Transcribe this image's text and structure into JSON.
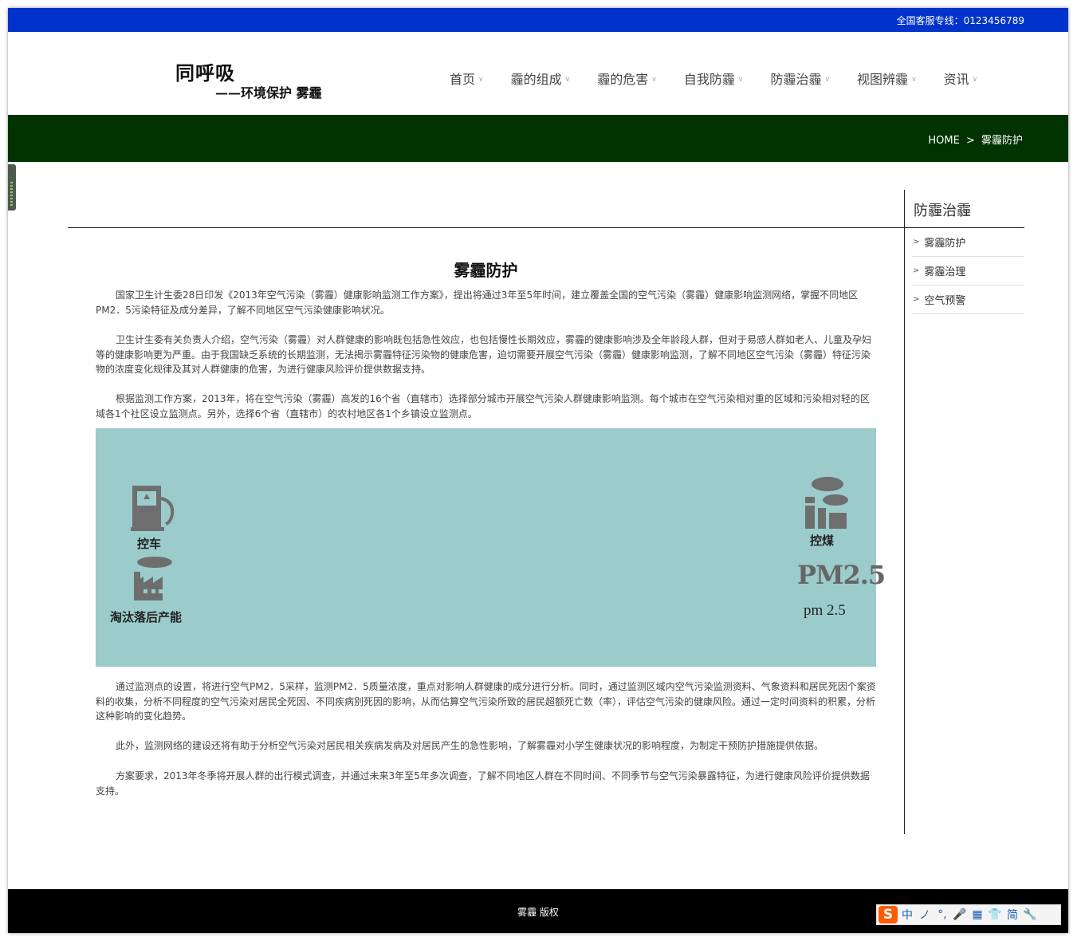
{
  "topbar": {
    "hotline": "全国客服专线：0123456789"
  },
  "logo": {
    "line1": "同呼吸",
    "line2": "——环境保护 雾霾"
  },
  "nav": {
    "items": [
      {
        "label": "首页"
      },
      {
        "label": "霾的组成"
      },
      {
        "label": "霾的危害"
      },
      {
        "label": "自我防霾"
      },
      {
        "label": "防霾治霾"
      },
      {
        "label": "视图辨霾"
      },
      {
        "label": "资讯"
      }
    ]
  },
  "breadcrumb": {
    "home": "HOME",
    "separator": ">",
    "current": "雾霾防护"
  },
  "sidebar": {
    "title": "防霾治霾",
    "items": [
      {
        "label": "雾霾防护"
      },
      {
        "label": "雾霾治理"
      },
      {
        "label": "空气预警"
      }
    ]
  },
  "article": {
    "title": "雾霾防护",
    "paragraphs": [
      "国家卫生计生委28日印发《2013年空气污染（雾霾）健康影响监测工作方案》，提出将通过3年至5年时间，建立覆盖全国的空气污染（雾霾）健康影响监测网络，掌握不同地区PM2．5污染特征及成分差异，了解不同地区空气污染健康影响状况。",
      "卫生计生委有关负责人介绍，空气污染（雾霾）对人群健康的影响既包括急性效应，也包括慢性长期效应，雾霾的健康影响涉及全年龄段人群，但对于易感人群如老人、儿童及孕妇等的健康影响更为严重。由于我国缺乏系统的长期监测，无法揭示雾霾特征污染物的健康危害，迫切需要开展空气污染（雾霾）健康影响监测，了解不同地区空气污染（雾霾）特征污染物的浓度变化规律及其对人群健康的危害，为进行健康风险评价提供数据支持。",
      "根据监测工作方案，2013年，将在空气污染（雾霾）高发的16个省（直辖市）选择部分城市开展空气污染人群健康影响监测。每个城市在空气污染相对重的区域和污染相对轻的区域各1个社区设立监测点。另外，选择6个省（直辖市）的农村地区各1个乡镇设立监测点。",
      "通过监测点的设置，将进行空气PM2．5采样，监测PM2．5质量浓度，重点对影响人群健康的成分进行分析。同时，通过监测区域内空气污染监测资料、气象资料和居民死因个案资料的收集，分析不同程度的空气污染对居民全死因、不同疾病别死因的影响，从而估算空气污染所致的居民超额死亡数（率），评估空气污染的健康风险。通过一定时间资料的积累，分析这种影响的变化趋势。",
      "此外，监测网络的建设还将有助于分析空气污染对居民相关疾病发病及对居民产生的急性影响，了解雾霾对小学生健康状况的影响程度，为制定干预防护措施提供依据。",
      "方案要求，2013年冬季将开展人群的出行模式调查，并通过未来3年至5年多次调查，了解不同地区人群在不同时间、不同季节与空气污染暴露特征，为进行健康风险评价提供数据支持。"
    ],
    "banner": {
      "label_car": "控车",
      "label_factory": "淘汰落后产能",
      "label_coal": "控煤",
      "pm_graphic": "PM2.5",
      "pm_text": "pm 2.5",
      "background": "#9ccbcb"
    }
  },
  "footer": {
    "copyright": "雾霾 版权"
  },
  "ime": {
    "logo": "S",
    "items": [
      "中",
      "ノ",
      "°,",
      "🎤",
      "▦",
      "👕",
      "简",
      "🔧"
    ]
  },
  "colors": {
    "topbar": "#0033cc",
    "crumbbar": "#003300",
    "footer": "#000000"
  }
}
